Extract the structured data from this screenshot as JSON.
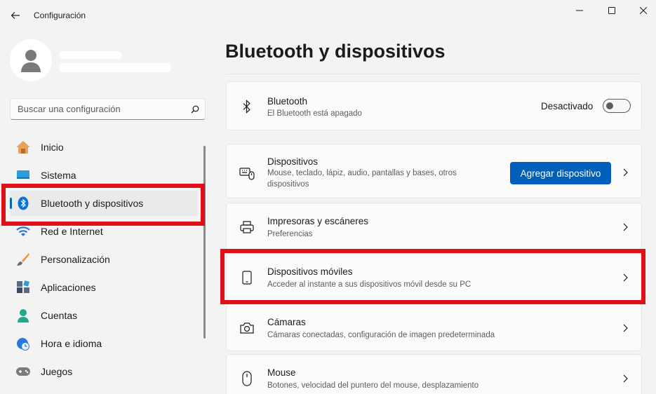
{
  "window": {
    "title": "Configuración"
  },
  "search": {
    "placeholder": "Buscar una configuración"
  },
  "sidebar": {
    "items": [
      {
        "label": "Inicio"
      },
      {
        "label": "Sistema"
      },
      {
        "label": "Bluetooth y dispositivos"
      },
      {
        "label": "Red e Internet"
      },
      {
        "label": "Personalización"
      },
      {
        "label": "Aplicaciones"
      },
      {
        "label": "Cuentas"
      },
      {
        "label": "Hora e idioma"
      },
      {
        "label": "Juegos"
      }
    ]
  },
  "main": {
    "title": "Bluetooth y dispositivos",
    "bluetooth": {
      "title": "Bluetooth",
      "subtitle": "El Bluetooth está apagado",
      "state_label": "Desactivado"
    },
    "devices": {
      "title": "Dispositivos",
      "subtitle": "Mouse, teclado, lápiz, audio, pantallas y bases, otros dispositivos",
      "button_label": "Agregar dispositivo"
    },
    "printers": {
      "title": "Impresoras y escáneres",
      "subtitle": "Preferencias"
    },
    "mobile": {
      "title": "Dispositivos móviles",
      "subtitle": "Acceder al instante a sus dispositivos móvil desde su PC"
    },
    "cameras": {
      "title": "Cámaras",
      "subtitle": "Cámaras conectadas, configuración de imagen predeterminada"
    },
    "mouse": {
      "title": "Mouse",
      "subtitle": "Botones, velocidad del puntero del mouse, desplazamiento"
    }
  },
  "colors": {
    "accent": "#005fb8",
    "highlight": "#e01018"
  }
}
